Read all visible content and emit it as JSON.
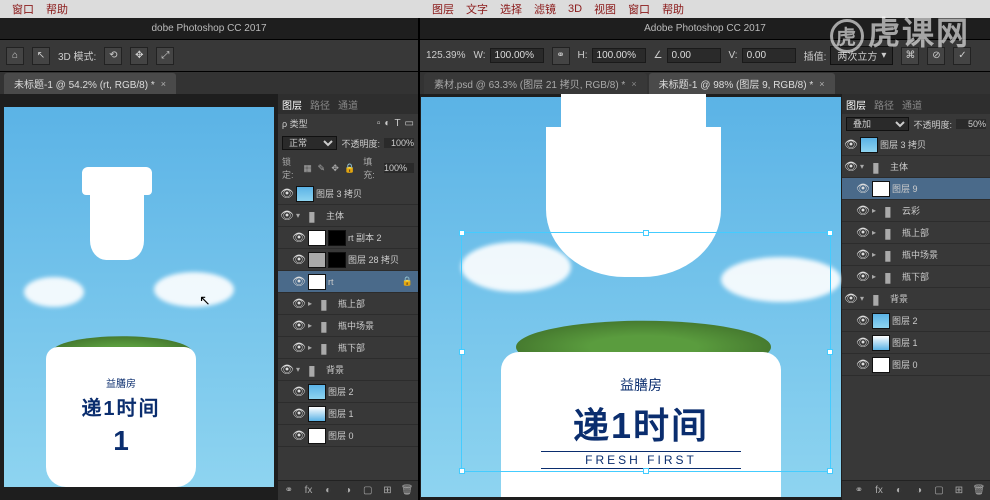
{
  "menubar_left": {
    "items": [
      "窗口",
      "帮助"
    ]
  },
  "menubar_right": {
    "items": [
      "图层",
      "文字",
      "选择",
      "滤镜",
      "3D",
      "视图",
      "窗口",
      "帮助"
    ]
  },
  "app_title_left": "dobe Photoshop CC 2017",
  "app_title_right": "Adobe Photoshop CC 2017",
  "toolbar_left": {
    "mode_label": "3D 模式:"
  },
  "toolbar_right": {
    "zoom": "125.39%",
    "w_label": "W:",
    "w_value": "100.00%",
    "h_label": "H:",
    "h_value": "100.00%",
    "angle": "0.00",
    "v_label": "V:",
    "v_value": "0.00",
    "interp_label": "插值:",
    "interp_value": "两次立方"
  },
  "tabs_left": {
    "active": "未标题-1 @ 54.2% (rt, RGB/8) *"
  },
  "tabs_right": {
    "inactive": "素材.psd @ 63.3% (图层 21 拷贝, RGB/8) *",
    "active": "未标题-1 @ 98% (图层 9, RGB/8) *"
  },
  "panel_tabs": {
    "layers": "图层",
    "channels": "路径",
    "paths": "通道"
  },
  "panel_left": {
    "kind_label": "ρ 类型",
    "blend_mode": "正常",
    "opacity_label": "不透明度:",
    "opacity_value": "100%",
    "lock_label": "锁定:",
    "fill_label": "填充:",
    "fill_value": "100%",
    "layers": [
      {
        "name": "图层 3 拷贝",
        "type": "normal",
        "sky": true
      },
      {
        "name": "主体",
        "type": "folder",
        "open": true
      },
      {
        "name": "rt 副本 2",
        "type": "normal",
        "indent": 1,
        "masked": true
      },
      {
        "name": "图层 28 拷贝",
        "type": "normal",
        "indent": 1,
        "masked": true,
        "gray": true
      },
      {
        "name": "rt",
        "type": "normal",
        "indent": 1,
        "selected": true,
        "locked": true,
        "white": true
      },
      {
        "name": "瓶上部",
        "type": "folder",
        "indent": 1
      },
      {
        "name": "瓶中场景",
        "type": "folder",
        "indent": 1
      },
      {
        "name": "瓶下部",
        "type": "folder",
        "indent": 1
      },
      {
        "name": "背景",
        "type": "folder",
        "open": true
      },
      {
        "name": "图层 2",
        "type": "normal",
        "indent": 1,
        "sky": true
      },
      {
        "name": "图层 1",
        "type": "normal",
        "indent": 1,
        "grad": true
      },
      {
        "name": "图层 0",
        "type": "normal",
        "indent": 1,
        "white": true
      }
    ]
  },
  "panel_right": {
    "blend_mode": "叠加",
    "opacity_label": "不透明度:",
    "opacity_value": "50%",
    "layers": [
      {
        "name": "图层 3 拷贝",
        "type": "normal",
        "sky": true
      },
      {
        "name": "主体",
        "type": "folder",
        "open": true
      },
      {
        "name": "图层 9",
        "type": "normal",
        "indent": 1,
        "selected": true,
        "white": true
      },
      {
        "name": "云彩",
        "type": "folder",
        "indent": 1
      },
      {
        "name": "瓶上部",
        "type": "folder",
        "indent": 1
      },
      {
        "name": "瓶中场景",
        "type": "folder",
        "indent": 1
      },
      {
        "name": "瓶下部",
        "type": "folder",
        "indent": 1
      },
      {
        "name": "背景",
        "type": "folder",
        "open": true
      },
      {
        "name": "图层 2",
        "type": "normal",
        "indent": 1,
        "sky": true
      },
      {
        "name": "图层 1",
        "type": "normal",
        "indent": 1,
        "grad": true
      },
      {
        "name": "图层 0",
        "type": "normal",
        "indent": 1,
        "white": true
      }
    ]
  },
  "bottle_label": {
    "brand": "益膳房",
    "main": "递1时间",
    "sub": "FRESH FIRST"
  },
  "watermark": "虎课网"
}
